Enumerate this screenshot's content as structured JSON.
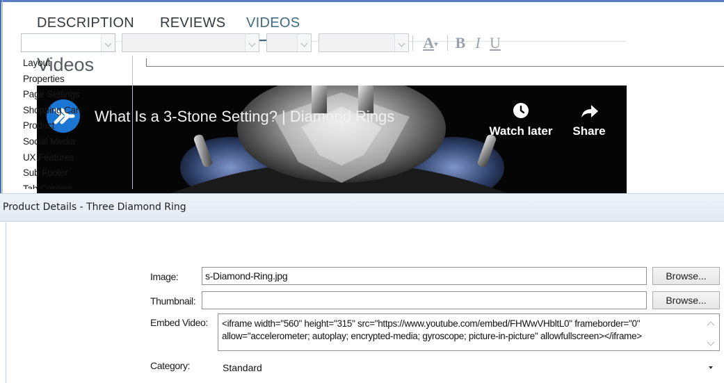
{
  "product_page": {
    "tabs": [
      {
        "label": "DESCRIPTION"
      },
      {
        "label": "REVIEWS"
      },
      {
        "label": "VIDEOS",
        "active": true
      }
    ],
    "section_title": "Videos",
    "video": {
      "title": "What Is a 3-Stone Setting? | Diamond Rings",
      "watch_later_label": "Watch later",
      "share_label": "Share",
      "logo_icon": "channel-logo-icon",
      "watch_later_icon": "clock-icon",
      "share_icon": "share-arrow-icon"
    }
  },
  "editor": {
    "window_title": "Product Details - Three Diamond Ring",
    "toolbar": {
      "font_color_icon": "font-color-icon",
      "bold_label": "B",
      "italic_label": "I",
      "underline_label": "U",
      "font_color_label": "A"
    },
    "nav_items": [
      {
        "label": "Layout"
      },
      {
        "label": "Properties"
      },
      {
        "label": "Page Settings"
      },
      {
        "label": "Shopping Cart"
      },
      {
        "label": "Product"
      },
      {
        "label": "Social Media"
      },
      {
        "label": "UX Features"
      },
      {
        "label": "Sub Footer"
      },
      {
        "label": "Tab Content"
      }
    ],
    "fields": {
      "image_label": "Image:",
      "image_value": "s-Diamond-Ring.jpg",
      "thumbnail_label": "Thumbnail:",
      "thumbnail_value": "",
      "browse_label": "Browse...",
      "embed_label": "Embed Video:",
      "embed_value": "<iframe width=\"560\" height=\"315\" src=\"https://www.youtube.com/embed/FHWwVHbltL0\" frameborder=\"0\" allow=\"accelerometer; autoplay; encrypted-media; gyroscope; picture-in-picture\" allowfullscreen></iframe>",
      "category_label": "Category:",
      "category_value": "Standard"
    }
  }
}
